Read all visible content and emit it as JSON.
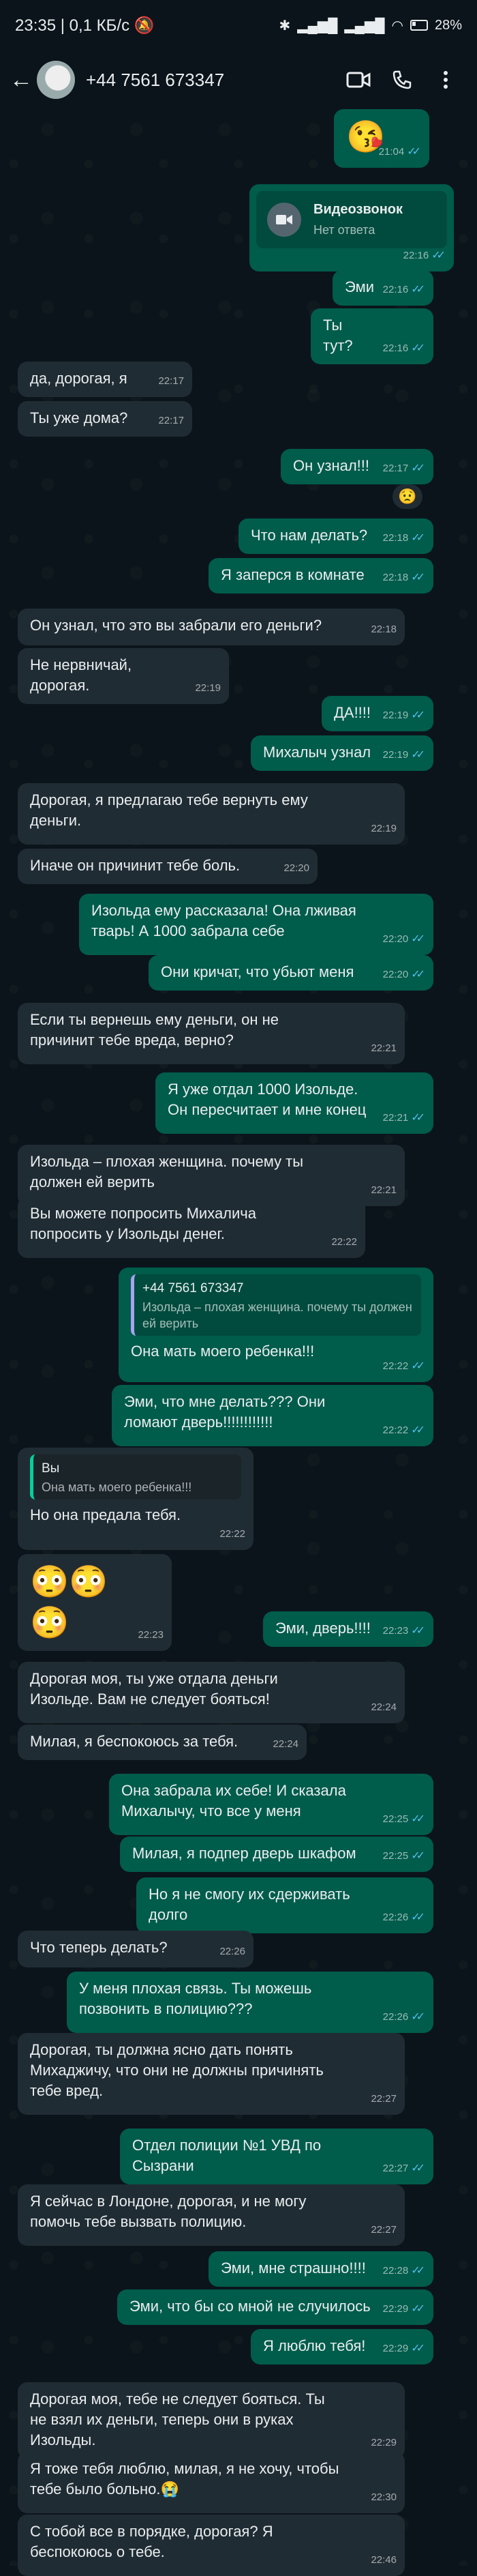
{
  "status": {
    "time": "23:35",
    "speed": "0,1 КБ/с",
    "battery": "28"
  },
  "header": {
    "contact": "+44 7561 673347"
  },
  "messages": [
    {
      "dir": "out",
      "text": "😘",
      "time": "21:04"
    },
    {
      "dir": "out",
      "call_title": "Видеозвонок",
      "call_sub": "Нет ответа",
      "time": "22:16"
    },
    {
      "dir": "out",
      "text": "Эми",
      "time": "22:16"
    },
    {
      "dir": "out",
      "text": "Ты тут?",
      "time": "22:16"
    },
    {
      "dir": "in",
      "text": "да, дорогая, я",
      "time": "22:17"
    },
    {
      "dir": "in",
      "text": "Ты уже дома?",
      "time": "22:17"
    },
    {
      "dir": "out",
      "text": "Он узнал!!!",
      "time": "22:17",
      "reaction": "😟"
    },
    {
      "dir": "out",
      "text": "Что нам делать?",
      "time": "22:18"
    },
    {
      "dir": "out",
      "text": "Я заперся в комнате",
      "time": "22:18"
    },
    {
      "dir": "in",
      "text": "Он узнал, что это вы забрали его деньги?",
      "time": "22:18"
    },
    {
      "dir": "in",
      "text": "Не нервничай, дорогая.",
      "time": "22:19"
    },
    {
      "dir": "out",
      "text": "ДА!!!!",
      "time": "22:19"
    },
    {
      "dir": "out",
      "text": "Михалыч узнал",
      "time": "22:19"
    },
    {
      "dir": "in",
      "text": "Дорогая, я предлагаю тебе вернуть ему деньги.",
      "time": "22:19"
    },
    {
      "dir": "in",
      "text": "Иначе он причинит тебе боль.",
      "time": "22:20"
    },
    {
      "dir": "out",
      "text": "Изольда ему рассказала! Она лживая тварь! А 1000 забрала себе",
      "time": "22:20"
    },
    {
      "dir": "out",
      "text": "Они кричат, что убьют меня",
      "time": "22:20"
    },
    {
      "dir": "in",
      "text": "Если ты вернешь ему деньги, он не причинит тебе вреда, верно?",
      "time": "22:21"
    },
    {
      "dir": "out",
      "text": "Я уже отдал 1000 Изольде. Он пересчитает и мне конец",
      "time": "22:21"
    },
    {
      "dir": "in",
      "text": "Изольда – плохая женщина. почему ты должен ей верить",
      "time": "22:21"
    },
    {
      "dir": "in",
      "text": "Вы можете попросить Михалича попросить у Изольды денег.",
      "time": "22:22"
    },
    {
      "dir": "out",
      "quote_name": "+44 7561 673347",
      "quote_text": "Изольда – плохая женщина. почему ты должен ей верить",
      "text": "Она мать моего ребенка!!!",
      "time": "22:22"
    },
    {
      "dir": "out",
      "text": "Эми, что мне делать??? Они ломают дверь!!!!!!!!!!!!",
      "time": "22:22"
    },
    {
      "dir": "in",
      "quote_name": "Вы",
      "quote_text": "Она мать моего ребенка!!!",
      "text": "Но она предала тебя.",
      "time": "22:22"
    },
    {
      "dir": "in",
      "text": "😳😳😳",
      "time": "22:23"
    },
    {
      "dir": "out",
      "text": "Эми, дверь!!!!",
      "time": "22:23"
    },
    {
      "dir": "in",
      "text": "Дорогая моя, ты уже отдала деньги Изольде. Вам не следует бояться!",
      "time": "22:24"
    },
    {
      "dir": "in",
      "text": "Милая, я беспокоюсь за тебя.",
      "time": "22:24"
    },
    {
      "dir": "out",
      "text": "Она забрала их себе! И сказала  Михалычу, что все у меня",
      "time": "22:25"
    },
    {
      "dir": "out",
      "text": "Милая, я подпер дверь шкафом",
      "time": "22:25"
    },
    {
      "dir": "out",
      "text": "Но я не смогу их сдерживать долго",
      "time": "22:26"
    },
    {
      "dir": "in",
      "text": "Что теперь делать?",
      "time": "22:26"
    },
    {
      "dir": "out",
      "text": "У меня плохая связь. Ты можешь позвонить в полицию???",
      "time": "22:26"
    },
    {
      "dir": "in",
      "text": "Дорогая, ты должна ясно дать понять Михаджичу, что они не должны причинять тебе вред.",
      "time": "22:27"
    },
    {
      "dir": "out",
      "text": "Отдел полиции №1 УВД по Сызрани",
      "time": "22:27"
    },
    {
      "dir": "in",
      "text": "Я сейчас в Лондоне, дорогая, и не могу помочь тебе вызвать полицию.",
      "time": "22:27"
    },
    {
      "dir": "out",
      "text": "Эми, мне страшно!!!!",
      "time": "22:28"
    },
    {
      "dir": "out",
      "text": "Эми, что бы со мной не случилось",
      "time": "22:29"
    },
    {
      "dir": "out",
      "text": "Я люблю тебя!",
      "time": "22:29"
    },
    {
      "dir": "in",
      "text": "Дорогая моя, тебе не следует бояться. Ты не взял их деньги, теперь они в руках Изольды.",
      "time": "22:29"
    },
    {
      "dir": "in",
      "text": "Я тоже тебя люблю, милая, я не хочу, чтобы тебе было больно.😭",
      "time": "22:30"
    },
    {
      "dir": "in",
      "text": "С тобой все в порядке, дорогая? Я беспокоюсь о тебе.",
      "time": "22:46"
    }
  ]
}
